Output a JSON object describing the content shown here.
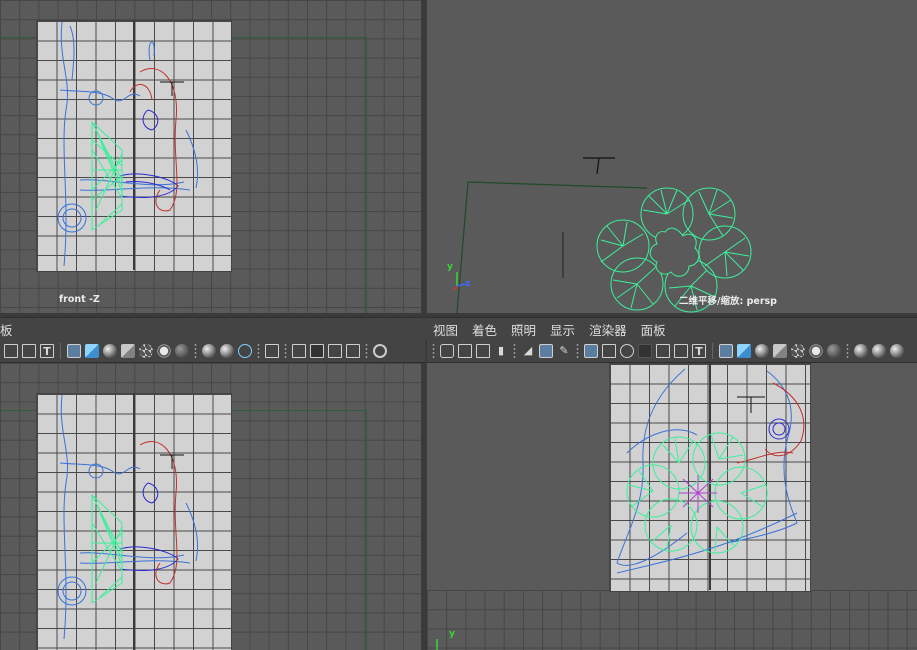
{
  "top_left_view": {
    "label": "front -Z"
  },
  "top_right_view": {
    "label": "二维平移/缩放: persp",
    "axis_y": "y",
    "axis_z": "z"
  },
  "bottom_left_view": {
    "menu_fragment": "板"
  },
  "bottom_right_view": {
    "menu": [
      "视图",
      "着色",
      "照明",
      "显示",
      "渲染器",
      "面板"
    ],
    "axis_y": "y"
  },
  "toolbar_icons": [
    "camera-select-icon",
    "camera-attributes-icon",
    "bookmark-icon",
    "image-plane-icon",
    "2d-pan-zoom-icon",
    "grease-pencil-icon",
    "grid-icon",
    "film-gate-icon",
    "resolution-gate-icon",
    "gate-mask-icon",
    "field-chart-icon",
    "safe-action-icon",
    "safe-title-icon",
    "wireframe-icon",
    "smooth-shade-icon",
    "default-material-icon",
    "textured-icon",
    "use-all-lights-icon",
    "shadows-icon",
    "screen-space-ao-icon",
    "motion-blur-icon",
    "anti-alias-icon",
    "isolate-select-icon",
    "xray-icon"
  ],
  "colors": {
    "viewport_bg": "#5a5a5a",
    "menubar_bg": "#444444",
    "selected_wire": "#3cf09a",
    "curve_blue": "#3a72d8",
    "curve_red": "#c0302a",
    "axis_y": "#34d834",
    "axis_z": "#3a6bff"
  }
}
